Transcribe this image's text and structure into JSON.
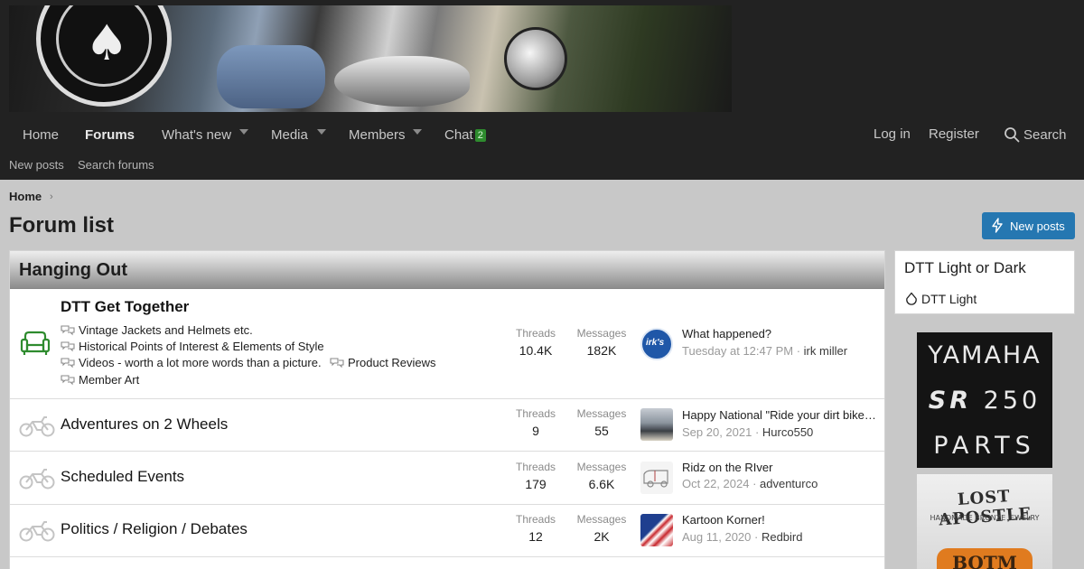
{
  "nav": {
    "items": [
      {
        "label": "Home",
        "active": false,
        "caret": false
      },
      {
        "label": "Forums",
        "active": true,
        "caret": false
      },
      {
        "label": "What's new",
        "active": false,
        "caret": true
      },
      {
        "label": "Media",
        "active": false,
        "caret": true
      },
      {
        "label": "Members",
        "active": false,
        "caret": true
      },
      {
        "label": "Chat",
        "active": false,
        "caret": false,
        "badge": "2"
      }
    ],
    "login": "Log in",
    "register": "Register",
    "search": "Search"
  },
  "subnav": {
    "new_posts": "New posts",
    "search_forums": "Search forums"
  },
  "breadcrumb": {
    "home": "Home"
  },
  "page": {
    "title": "Forum list",
    "new_posts_button": "New posts"
  },
  "category": {
    "title": "Hanging Out",
    "stat_threads_label": "Threads",
    "stat_messages_label": "Messages",
    "nodes": [
      {
        "title": "DTT Get Together",
        "bold": true,
        "threads": "10.4K",
        "messages": "182K",
        "subforums": [
          "Vintage Jackets and Helmets etc.",
          "Historical Points of Interest & Elements of Style",
          "Videos - worth a lot more words than a picture.",
          "Product Reviews",
          "Member Art"
        ],
        "last_title": "What happened?",
        "last_date": "Tuesday at 12:47 PM",
        "last_user": "irk miller",
        "avatar_text": "irk's"
      },
      {
        "title": "Adventures on 2 Wheels",
        "bold": false,
        "threads": "9",
        "messages": "55",
        "last_title": "Happy National \"Ride your dirt bike to work day\"",
        "last_date": "Sep 20, 2021",
        "last_user": "Hurco550"
      },
      {
        "title": "Scheduled Events",
        "bold": false,
        "threads": "179",
        "messages": "6.6K",
        "last_title": "Ridz on the RIver",
        "last_date": "Oct 22, 2024",
        "last_user": "adventurco"
      },
      {
        "title": "Politics / Religion / Debates",
        "bold": false,
        "threads": "12",
        "messages": "2K",
        "last_title": "Kartoon Korner!",
        "last_date": "Aug 11, 2020",
        "last_user": "Redbird"
      }
    ]
  },
  "sidebar": {
    "style_title": "DTT Light or Dark",
    "style_option": "DTT Light",
    "ad1": {
      "line1": "YAMAHA",
      "line2a": "SR",
      "line2b": "250",
      "line3": "PARTS"
    },
    "ad2": {
      "line1": "LOST APOSTLE",
      "line2": "HANDMADE BRONZE JEWELRY",
      "line3": "BOTM"
    }
  },
  "colors": {
    "accent": "#2577b1",
    "active_icon": "#2e8b2e",
    "inactive_icon": "#c4c4c4",
    "nav_bg": "#222222"
  }
}
